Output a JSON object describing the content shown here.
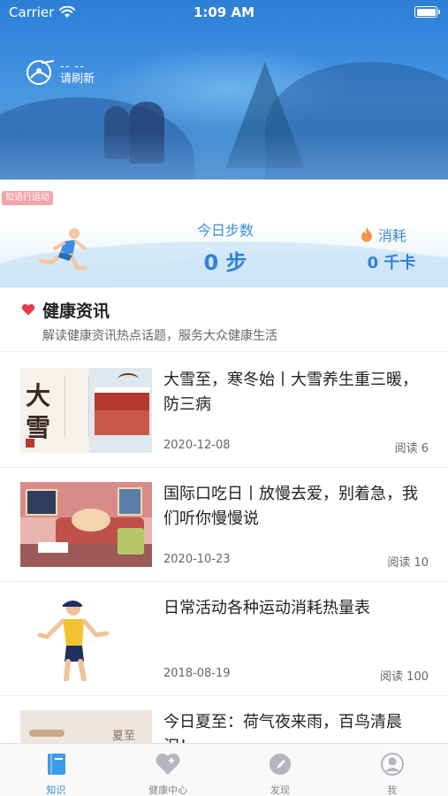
{
  "status_bar": {
    "carrier": "Carrier",
    "time": "1:09 AM"
  },
  "weather": {
    "temperature": "-- --",
    "refresh": "请刷新"
  },
  "steps_card": {
    "tag": "知语行运动",
    "steps_label": "今日步数",
    "steps_value": "0 步",
    "burn_label": "消耗",
    "burn_value": "0 千卡"
  },
  "section": {
    "title": "健康资讯",
    "subtitle": "解读健康资讯热点话题，服务大众健康生活"
  },
  "news": [
    {
      "title": "大雪至，寒冬始丨大雪养生重三暖，防三病",
      "date": "2020-12-08",
      "reads": "阅读 6"
    },
    {
      "title": "国际口吃日丨放慢去爱，别着急，我们听你慢慢说",
      "date": "2020-10-23",
      "reads": "阅读 10"
    },
    {
      "title": "日常活动各种运动消耗热量表",
      "date": "2018-08-19",
      "reads": "阅读 100"
    },
    {
      "title": "今日夏至：荷气夜来雨，百鸟清晨泪！",
      "date": "",
      "reads": ""
    }
  ],
  "thumb_text": {
    "daxue_char1": "大",
    "daxue_char2": "雪",
    "xiazhi": "夏至"
  },
  "tabs": [
    {
      "label": "知识",
      "icon": "book-icon",
      "active": true
    },
    {
      "label": "健康中心",
      "icon": "heart-plus-icon",
      "active": false
    },
    {
      "label": "发现",
      "icon": "compass-icon",
      "active": false
    },
    {
      "label": "我",
      "icon": "user-icon",
      "active": false
    }
  ],
  "colors": {
    "accent": "#2f8be0",
    "tag_bg": "#f4a3a9",
    "heart": "#e83a4a",
    "flame": "#f5924a"
  }
}
